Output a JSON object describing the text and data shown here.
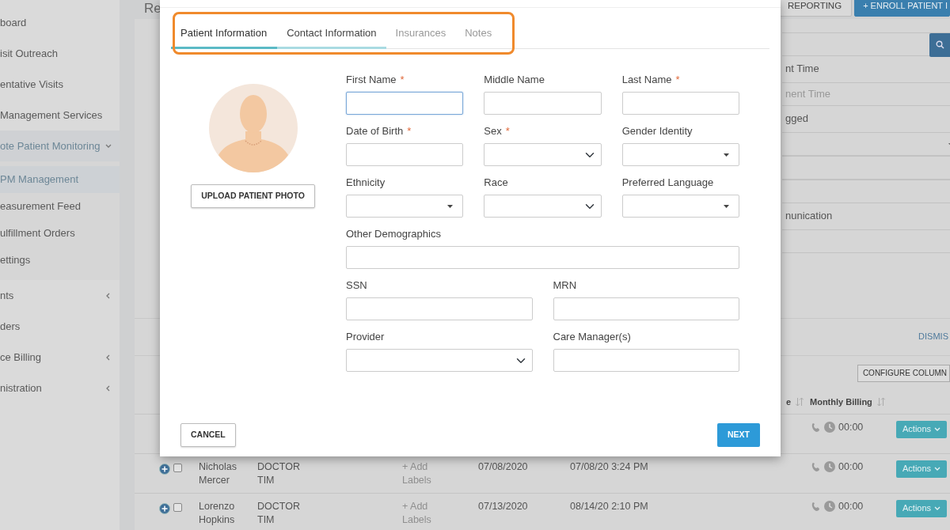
{
  "sidebar": {
    "items": [
      {
        "label": "board"
      },
      {
        "label": "isit Outreach"
      },
      {
        "label": "entative Visits"
      },
      {
        "label": "Management Services"
      },
      {
        "label": "ote Patient Monitoring",
        "expanded": true,
        "children": [
          {
            "label": "PM Management",
            "selected": true
          },
          {
            "label": "easurement Feed",
            "selected": false
          },
          {
            "label": "ulfillment Orders",
            "selected": false
          },
          {
            "label": "ettings",
            "selected": false
          }
        ]
      },
      {
        "label": "nts",
        "expanded": false
      },
      {
        "label": "ders"
      },
      {
        "label": "ce Billing",
        "expanded": false
      },
      {
        "label": "nistration",
        "expanded": false
      }
    ]
  },
  "header": {
    "title": "Re",
    "buttons": [
      {
        "label": "REPORTING",
        "kind": "secondary"
      },
      {
        "label": "+ ENROLL PATIENT I",
        "kind": "primary"
      }
    ]
  },
  "filters": [
    {
      "kind": "search"
    },
    {
      "kind": "label",
      "text": "nt Time"
    },
    {
      "kind": "field",
      "placeholder": "nent Time"
    },
    {
      "kind": "label",
      "text": "gged"
    },
    {
      "kind": "select"
    },
    {
      "kind": "field"
    },
    {
      "kind": "field"
    },
    {
      "kind": "label",
      "text": "nunication"
    },
    {
      "kind": "field"
    }
  ],
  "dismiss_link": "DISMIS",
  "configure_button": "CONFIGURE COLUMN",
  "table": {
    "columns": [
      {
        "label": "e"
      },
      {
        "label": "Monthly Billing"
      }
    ],
    "rows": [
      {
        "billing": "00:00",
        "action": "Actions"
      },
      {
        "checked": false,
        "name": "Nicholas Mercer",
        "provider": "DOCTOR TIM",
        "labels": "+ Add Labels",
        "enrolled": "07/08/2020",
        "last": "07/08/20 3:24 PM",
        "billing": "00:00",
        "action": "Actions"
      },
      {
        "checked": false,
        "name": "Lorenzo Hopkins",
        "provider": "DOCTOR TIM",
        "labels": "+ Add Labels",
        "enrolled": "07/13/2020",
        "last": "08/14/20 2:10 PM",
        "billing": "00:00",
        "action": "Actions"
      }
    ]
  },
  "modal": {
    "tabs": [
      {
        "label": "Patient Information",
        "selected": true,
        "visited": true
      },
      {
        "label": "Contact Information",
        "selected": false,
        "visited": true
      },
      {
        "label": "Insurances",
        "selected": false,
        "visited": false
      },
      {
        "label": "Notes",
        "selected": false,
        "visited": false
      }
    ],
    "photo_button": "UPLOAD PATIENT PHOTO",
    "rows": [
      [
        {
          "label": "First Name",
          "required_mark": "*",
          "kind": "text",
          "focused": true
        },
        {
          "label": "Middle Name",
          "kind": "text",
          "focused": false
        },
        {
          "label": "Last Name",
          "required_mark": "*",
          "kind": "text",
          "focused": false
        }
      ],
      [
        {
          "label": "Date of Birth",
          "required_mark": "*",
          "kind": "text",
          "focused": false
        },
        {
          "label": "Sex",
          "required_mark": "*",
          "kind": "select",
          "focused": false
        },
        {
          "label": "Gender Identity",
          "kind": "dropdown",
          "focused": false
        }
      ],
      [
        {
          "label": "Ethnicity",
          "kind": "dropdown",
          "focused": false
        },
        {
          "label": "Race",
          "kind": "select",
          "focused": false
        },
        {
          "label": "Preferred Language",
          "kind": "dropdown",
          "focused": false
        }
      ],
      [
        {
          "label": "Other Demographics",
          "kind": "text",
          "focused": false
        }
      ],
      [
        {
          "label": "SSN",
          "kind": "text",
          "focused": false
        },
        {
          "label": "MRN",
          "kind": "text",
          "focused": false
        }
      ],
      [
        {
          "label": "Provider",
          "kind": "select",
          "focused": false
        },
        {
          "label": "Care Manager(s)",
          "kind": "text",
          "focused": false
        }
      ]
    ],
    "cancel_button": "CANCEL",
    "next_button": "NEXT"
  }
}
